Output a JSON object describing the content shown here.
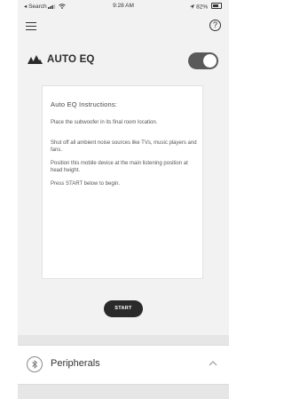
{
  "status_bar": {
    "carrier": "◂ Search",
    "time": "9:28 AM",
    "battery": "82%"
  },
  "header": {
    "menu_icon": "menu-icon",
    "help_icon": "help-icon",
    "help_glyph": "?"
  },
  "auto_eq": {
    "logo_icon": "mountains-logo-icon",
    "title": "AUTO EQ",
    "toggle_on": true
  },
  "instructions": {
    "title": "Auto EQ Instructions:",
    "paragraphs": [
      "Place the subwoofer in its final room location.",
      "Shut off all ambient noise sources like TVs, music players and fans.",
      "Position this mobile device at the main listening position at head height.",
      "Press START below to begin."
    ]
  },
  "start_button": {
    "label": "START"
  },
  "peripherals": {
    "icon": "bluetooth-icon",
    "label": "Peripherals",
    "chevron": "chevron-up-icon"
  },
  "colors": {
    "background": "#f2f2f2",
    "card": "#ffffff",
    "toggle": "#595959",
    "button": "#2a2a2a"
  }
}
